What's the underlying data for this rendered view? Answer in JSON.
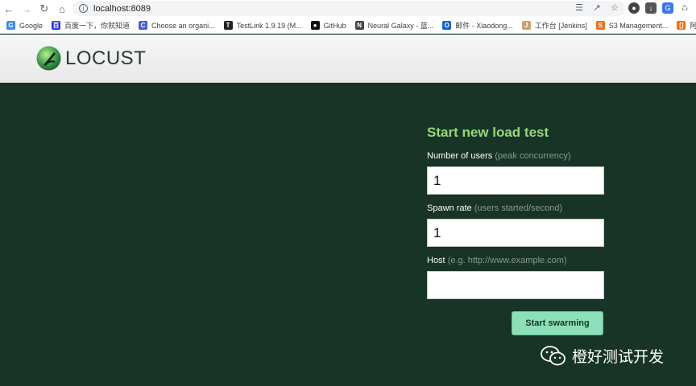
{
  "browser": {
    "url": "localhost:8089",
    "bookmarks": [
      {
        "label": "Google",
        "icon": "google-icon",
        "color": "#4285f4",
        "glyph": "G"
      },
      {
        "label": "百度一下，你就知道",
        "icon": "baidu-icon",
        "color": "#2932e1",
        "glyph": "百"
      },
      {
        "label": "Choose an organi...",
        "icon": "organization-icon",
        "color": "#4a5cd6",
        "glyph": "C"
      },
      {
        "label": "TestLink 1.9.19 (M...",
        "icon": "testlink-icon",
        "color": "#222222",
        "glyph": "T"
      },
      {
        "label": "GitHub",
        "icon": "github-icon",
        "color": "#111111",
        "glyph": "●"
      },
      {
        "label": "Neural Galaxy - 蓝...",
        "icon": "neural-galaxy-icon",
        "color": "#444444",
        "glyph": "N"
      },
      {
        "label": "邮件 - Xiaodong...",
        "icon": "outlook-icon",
        "color": "#0a64d4",
        "glyph": "O"
      },
      {
        "label": "工作台 [Jenkins]",
        "icon": "jenkins-icon",
        "color": "#c9a46b",
        "glyph": "J"
      },
      {
        "label": "S3 Management...",
        "icon": "aws-s3-icon",
        "color": "#e8731a",
        "glyph": "S"
      },
      {
        "label": "阿里云控制台首页",
        "icon": "aliyun-icon",
        "color": "#ff6a00",
        "glyph": "[]"
      }
    ]
  },
  "app": {
    "logo_text": "LOCUST"
  },
  "form": {
    "title": "Start new load test",
    "users_label": "Number of users",
    "users_hint": "(peak concurrency)",
    "users_value": "1",
    "spawn_label": "Spawn rate",
    "spawn_hint": "(users started/second)",
    "spawn_value": "1",
    "host_label": "Host",
    "host_hint": "(e.g. http://www.example.com)",
    "host_value": "",
    "submit_label": "Start swarming"
  },
  "watermark": {
    "text": "橙好测试开发"
  },
  "colors": {
    "background": "#173426",
    "title": "#97d77a",
    "button": "#8ce0b9"
  }
}
